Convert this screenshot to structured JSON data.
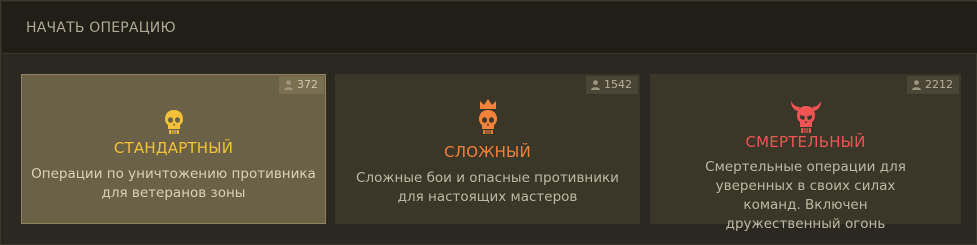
{
  "header": {
    "title": "НАЧАТЬ ОПЕРАЦИЮ"
  },
  "modes": [
    {
      "name": "СТАНДАРТНЫЙ",
      "players": "372",
      "description": "Операции по уничтожению противника для ветеранов зоны",
      "color": "#f3c23a",
      "icon": "skull-icon",
      "selected": true
    },
    {
      "name": "СЛОЖНЫЙ",
      "players": "1542",
      "description": "Сложные бои и опасные противники для настоящих мастеров",
      "color": "#f2813a",
      "icon": "crowned-skull-icon",
      "selected": false
    },
    {
      "name": "СМЕРТЕЛЬНЫЙ",
      "players": "2212",
      "description": "Смертельные операции для уверенных в своих силах команд. Включен дружественный огонь",
      "color": "#f05454",
      "icon": "horned-skull-icon",
      "selected": false
    }
  ]
}
